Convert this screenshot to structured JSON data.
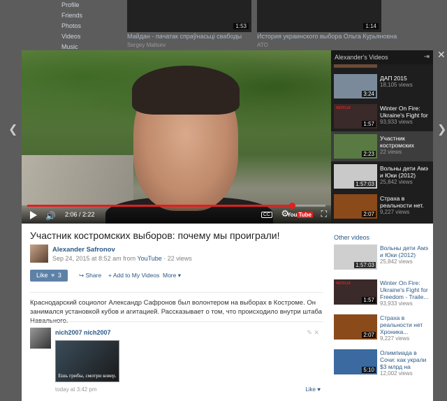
{
  "background": {
    "sidebar": [
      "Profile",
      "Friends",
      "Photos",
      "Videos",
      "Music"
    ],
    "cards": [
      {
        "duration": "1:53",
        "caption": "Майдан - пачатак спраўнасьці свабоды",
        "sub": "Sergey Maltsev"
      },
      {
        "duration": "1:14",
        "caption": "История украинского выбора Ольга Курьяновна",
        "sub": "ATO"
      }
    ]
  },
  "player": {
    "time": "2:06 / 2:22",
    "progress_fraction": 0.887,
    "youtube_label": "You",
    "youtube_tube": "Tube"
  },
  "playlist": {
    "header": "Alexander's Videos",
    "items": [
      {
        "title": "ДАП 2015",
        "views": "18,105 views",
        "duration": "3:24",
        "thumb": "#7a8a9a",
        "netflix": false,
        "active": false
      },
      {
        "title": "Winter On Fire: Ukraine's Fight for",
        "views": "93,933 views",
        "duration": "1:57",
        "thumb": "#3b2a2a",
        "netflix": true,
        "active": false
      },
      {
        "title": "Участник костромских",
        "views": "22 views",
        "duration": "2:23",
        "thumb": "#5a7a44",
        "netflix": false,
        "active": true
      },
      {
        "title": "Вольны дети Амэ и Юки (2012)",
        "views": "25,842 views",
        "duration": "1:57:03",
        "thumb": "#c9c9c9",
        "netflix": false,
        "active": false
      },
      {
        "title": "Страха в реальности нет.",
        "views": "9,227 views",
        "duration": "2:07",
        "thumb": "#8a4a1a",
        "netflix": false,
        "active": false
      }
    ]
  },
  "video": {
    "title": "Участник костромских выборов: почему мы проиграли!",
    "author": "Alexander Safronov",
    "date": "Sep 24, 2015 at 8:52 am from ",
    "source": "YouTube",
    "views": " · 22 views",
    "like_label": "Like",
    "like_count": "3",
    "share_label": "Share",
    "add_label": "Add to My Videos",
    "more_label": "More",
    "description": "Краснодарский социолог Александр Сафронов был волонтером на выборах в Костроме. Он занимался установкой кубов и агитацией. Рассказывает о том, что происходило внутри штаба Навального."
  },
  "comment": {
    "author": "nich2007 nich2007",
    "image_caption": "Ешь грибы, смотри ковер.",
    "time": "today at 3:42 pm",
    "like_label": "Like"
  },
  "other_videos": {
    "header": "Other videos",
    "items": [
      {
        "title": "Вольны дети Амэ и Юки (2012)",
        "views": "25,842 views",
        "duration": "1:57:03",
        "thumb": "#cfcfcf",
        "netflix": false
      },
      {
        "title": "Winter On Fire: Ukraine's Fight for Freedom - Traile...",
        "views": "93,933 views",
        "duration": "1:57",
        "thumb": "#3b2a2a",
        "netflix": true
      },
      {
        "title": "Страха в реальности нет Хроника...",
        "views": "9,227 views",
        "duration": "2:07",
        "thumb": "#8a4a1a",
        "netflix": false
      },
      {
        "title": "Олимпиада в Сочи: как украли $3 млрд на",
        "views": "12,002 views",
        "duration": "5:10",
        "thumb": "#3a6aa0",
        "netflix": false
      }
    ]
  },
  "icons": {
    "close": "✕",
    "prev": "❮",
    "next": "❯",
    "gear": "⚙",
    "fullscreen": "⛶",
    "speaker": "🔊",
    "expand": "⇥",
    "share": "↪",
    "plus": "+",
    "caret": "▾",
    "pencil": "✎",
    "x": "✕",
    "heart": "♥",
    "smile": "☺",
    "cc": "CC"
  }
}
